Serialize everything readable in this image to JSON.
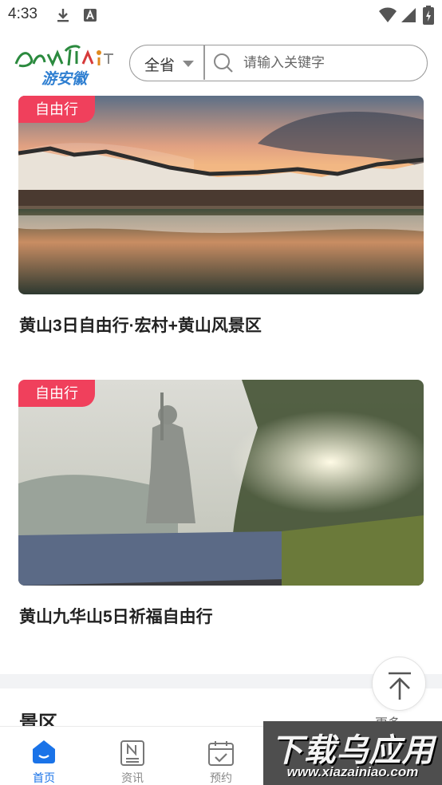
{
  "status_bar": {
    "time": "4:33",
    "icons": [
      "download-icon",
      "a-badge-icon",
      "wifi-icon",
      "signal-icon",
      "battery-icon"
    ]
  },
  "header": {
    "logo_text": "Anhui",
    "logo_subtext": "游安徽",
    "province_label": "全省",
    "search_placeholder": "请输入关键字"
  },
  "cards": [
    {
      "tag": "自由行",
      "title": "黄山3日自由行·宏村+黄山风景区",
      "image": "hongcun-village-sunset-photo"
    },
    {
      "tag": "自由行",
      "title": "黄山九华山5日祈福自由行",
      "image": "jiuhuashan-buddha-statue-photo"
    }
  ],
  "section": {
    "title": "景区",
    "more": "更多"
  },
  "bottom_nav": [
    {
      "label": "首页",
      "icon": "home-icon",
      "active": true
    },
    {
      "label": "资讯",
      "icon": "news-icon",
      "active": false
    },
    {
      "label": "预约",
      "icon": "calendar-check-icon",
      "active": false
    }
  ],
  "watermark": {
    "main": "下载乌应用",
    "sub": "www.xiazainiao.com"
  },
  "colors": {
    "accent": "#1a73e8",
    "tag": "#f0405c",
    "section_bg": "#f2f3f5"
  }
}
